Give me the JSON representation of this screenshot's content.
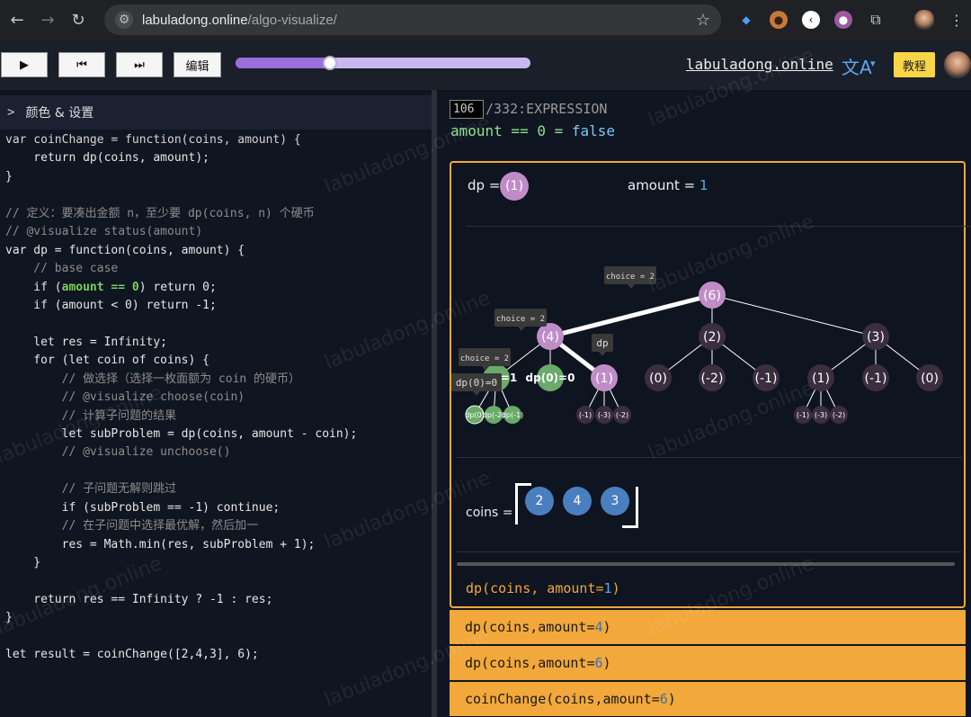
{
  "browser": {
    "url_domain": "labuladong.online",
    "url_path": "/algo-visualize/",
    "back_icon": "back-arrow-icon",
    "forward_icon": "forward-arrow-icon",
    "reload_icon": "reload-icon"
  },
  "toolbar": {
    "play_glyph": "▶",
    "prev_glyph": "⏮",
    "next_glyph": "⏭",
    "edit_label": "编辑",
    "progress": 0.32,
    "site_link": "labuladong.online",
    "tutorial_label": "教程",
    "lang_glyph": "文A"
  },
  "left": {
    "settings_label": "颜色 & 设置",
    "code_lines": [
      [
        {
          "t": "var coinChange = function(coins, amount) {",
          "c": "c-var"
        }
      ],
      [
        {
          "t": "    return dp(coins, amount);",
          "c": ""
        }
      ],
      [
        {
          "t": "}",
          "c": ""
        }
      ],
      [
        {
          "t": "",
          "c": ""
        }
      ],
      [
        {
          "t": "// 定义：要凑出金额 n，至少要 dp(coins, n) 个硬币",
          "c": "c-cm"
        }
      ],
      [
        {
          "t": "// @visualize status(amount)",
          "c": "c-cm"
        }
      ],
      [
        {
          "t": "var dp = function(coins, amount) {",
          "c": ""
        }
      ],
      [
        {
          "t": "    // base case",
          "c": "c-cm"
        }
      ],
      [
        {
          "t": "    if (",
          "c": ""
        },
        {
          "t": "amount == 0",
          "c": "c-hl"
        },
        {
          "t": ") return 0;",
          "c": ""
        }
      ],
      [
        {
          "t": "    if (amount < 0) return -1;",
          "c": ""
        }
      ],
      [
        {
          "t": "",
          "c": ""
        }
      ],
      [
        {
          "t": "    let res = Infinity;",
          "c": ""
        }
      ],
      [
        {
          "t": "    for (let coin of coins) {",
          "c": ""
        }
      ],
      [
        {
          "t": "        // 做选择（选择一枚面额为 coin 的硬币）",
          "c": "c-cm"
        }
      ],
      [
        {
          "t": "        // @visualize choose(coin)",
          "c": "c-cm"
        }
      ],
      [
        {
          "t": "        // 计算子问题的结果",
          "c": "c-cm"
        }
      ],
      [
        {
          "t": "        let subProblem = dp(coins, amount - coin);",
          "c": ""
        }
      ],
      [
        {
          "t": "        // @visualize unchoose()",
          "c": "c-cm"
        }
      ],
      [
        {
          "t": "",
          "c": ""
        }
      ],
      [
        {
          "t": "        // 子问题无解则跳过",
          "c": "c-cm"
        }
      ],
      [
        {
          "t": "        if (subProblem == -1) continue;",
          "c": ""
        }
      ],
      [
        {
          "t": "        // 在子问题中选择最优解，然后加一",
          "c": "c-cm"
        }
      ],
      [
        {
          "t": "        res = Math.min(res, subProblem + 1);",
          "c": ""
        }
      ],
      [
        {
          "t": "    }",
          "c": ""
        }
      ],
      [
        {
          "t": "",
          "c": ""
        }
      ],
      [
        {
          "t": "    return res == Infinity ? -1 : res;",
          "c": ""
        }
      ],
      [
        {
          "t": "}",
          "c": ""
        }
      ],
      [
        {
          "t": "",
          "c": ""
        }
      ],
      [
        {
          "t": "let result = coinChange([2,4,3], 6);",
          "c": ""
        }
      ]
    ]
  },
  "right": {
    "step_current": "106",
    "step_total": "/332:EXPRESSION",
    "expr_left": "amount == 0 = ",
    "expr_value": "false",
    "dp_label": "dp =",
    "dp_value": "(1)",
    "amount_label": "amount = ",
    "amount_value": "1",
    "coins_label": "coins =",
    "coins": [
      "2",
      "4",
      "3"
    ],
    "frame_title_prefix": "dp(coins, amount=",
    "frame_title_value": "1",
    "frame_title_suffix": ")",
    "call_stack": [
      {
        "prefix": "dp(coins,amount=",
        "value": "4",
        "suffix": ")"
      },
      {
        "prefix": "dp(coins,amount=",
        "value": "6",
        "suffix": ")"
      },
      {
        "prefix": "coinChange(coins,amount=",
        "value": "6",
        "suffix": ")"
      }
    ],
    "tree": {
      "root": "(6)",
      "tooltip_root": "choice = 2",
      "tooltip_left": "choice = 2",
      "tooltip_leftleft": "choice = 2",
      "dp_tag": "dp",
      "dp0_tag": "dp(0)=0",
      "nodes": [
        "(4)",
        "(2)",
        "(3)",
        "dp(0)=0",
        "(1)",
        "(0)",
        "(-2)",
        "(-1)",
        "(1)",
        "(-1)",
        "(0)",
        "=1"
      ],
      "leaves_left": [
        "dp(0)",
        "dp(-2)",
        "dp(-1)"
      ],
      "leaves_one": [
        "(-1)",
        "(-3)",
        "(-2)"
      ],
      "leaves_right": [
        "(-1)",
        "(-3)",
        "(-2)"
      ]
    }
  },
  "watermark_text": "labuladong.online"
}
